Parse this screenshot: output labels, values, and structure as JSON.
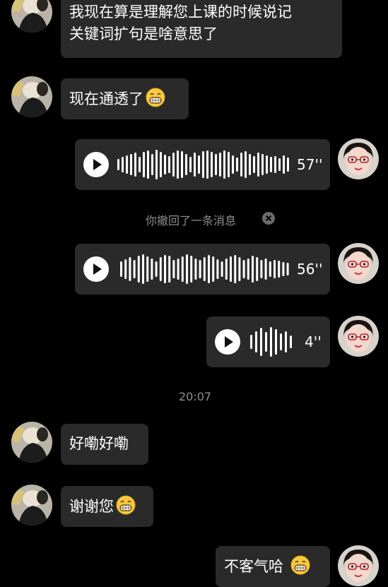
{
  "messages": {
    "m1": {
      "line1": "我现在算是理解您上课的时候说记",
      "line2": "关键词扩句是啥意思了"
    },
    "m2": {
      "text": "现在通透了",
      "emoji": "grinning-face-emoji"
    },
    "v1": {
      "duration": "57''"
    },
    "recall_notice": "你撤回了一条消息",
    "v2": {
      "duration": "56''"
    },
    "v3": {
      "duration": "4''"
    },
    "timestamp": "20:07",
    "m3": {
      "text": "好嘞好嘞"
    },
    "m4": {
      "text": "谢谢您",
      "emoji": "grinning-face-emoji"
    },
    "m5": {
      "text": "不客气哈",
      "emoji": "grinning-face-emoji"
    }
  },
  "colors": {
    "background": "#000000",
    "bubble": "#2a2a2a",
    "meta_text": "#8e8e8e"
  }
}
